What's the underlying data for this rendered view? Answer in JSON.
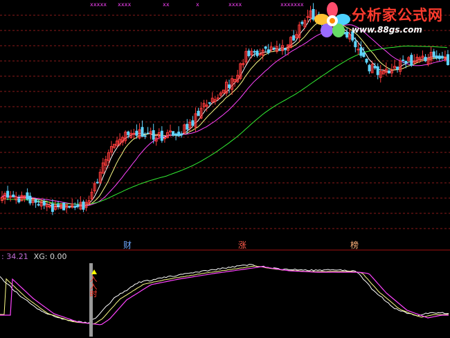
{
  "watermark": {
    "title": "分析家公式网",
    "url": "www.88gs.com",
    "logo_icon": "flower-logo-icon"
  },
  "top_markers": [
    "xxxxx",
    "xxxx",
    "xx",
    "x",
    "xxxx",
    "xxxxxxx",
    "x",
    "xxxxxxxx"
  ],
  "event_labels": [
    {
      "text": "财",
      "color": "#6fa8ff"
    },
    {
      "text": "涨",
      "color": "#ff5a4a"
    },
    {
      "text": "榜",
      "color": "#ffb27a"
    }
  ],
  "indicator": {
    "value_text": ": 34.21",
    "xg_label": "XG:",
    "xg_value": "0.00",
    "signal_text": "入\n入\n时",
    "signal_icon": "yellow-triangle-icon"
  },
  "colors": {
    "background": "#000000",
    "grid": "#8b1a1a",
    "separator": "#a01010",
    "up_candle": "#ff3b3b",
    "down_candle": "#5fd4ff",
    "ma_short": "#ffffff",
    "ma_mid": "#ffff88",
    "ma_long": "#ff44ff",
    "ma_longest": "#33ee33",
    "ind_white": "#ffffff",
    "ind_yellow": "#ffff88",
    "ind_magenta": "#ff44ff"
  }
}
